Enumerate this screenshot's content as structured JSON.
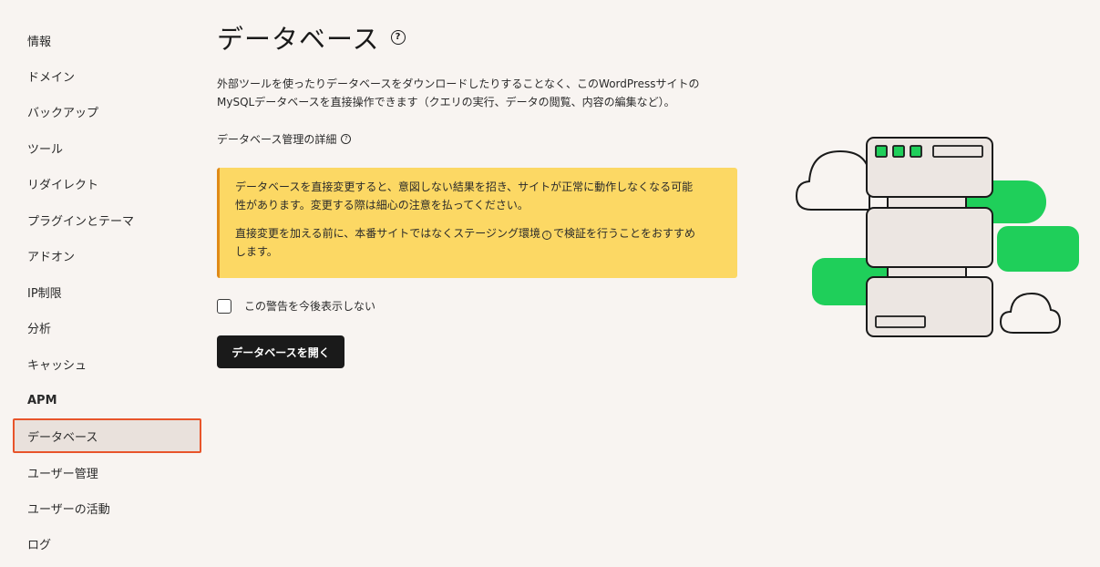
{
  "sidebar": {
    "items": [
      {
        "label": "情報"
      },
      {
        "label": "ドメイン"
      },
      {
        "label": "バックアップ"
      },
      {
        "label": "ツール"
      },
      {
        "label": "リダイレクト"
      },
      {
        "label": "プラグインとテーマ"
      },
      {
        "label": "アドオン"
      },
      {
        "label": "IP制限"
      },
      {
        "label": "分析"
      },
      {
        "label": "キャッシュ"
      },
      {
        "label": "APM"
      },
      {
        "label": "データベース"
      },
      {
        "label": "ユーザー管理"
      },
      {
        "label": "ユーザーの活動"
      },
      {
        "label": "ログ"
      }
    ],
    "active_label": "データベース"
  },
  "main": {
    "title": "データベース",
    "description_line1": "外部ツールを使ったりデータベースをダウンロードしたりすることなく、このWordPressサイトの",
    "description_line2": "MySQLデータベースを直接操作できます（クエリの実行、データの閲覧、内容の編集など）。",
    "details_link": "データベース管理の詳細",
    "warning": {
      "paragraph1_line1": "データベースを直接変更すると、意図しない結果を招き、サイトが正常に動作しなくなる可能",
      "paragraph1_line2": "性があります。変更する際は細心の注意を払ってください。",
      "paragraph2_before_icon": "直接変更を加える前に、本番サイトではなくステージング環境",
      "paragraph2_after_icon": "で検証を行うことをおすすめ",
      "paragraph2_line2": "します。"
    },
    "dont_show_label": "この警告を今後表示しない",
    "open_button_label": "データベースを開く"
  },
  "icons": {
    "title_help": "?",
    "details_help": "?",
    "staging_info": "i"
  },
  "colors": {
    "background": "#f8f4f1",
    "warning_bg": "#fcd864",
    "warning_border": "#e08a17",
    "active_border": "#e8542a",
    "active_bg": "#e9e1dc",
    "button_bg": "#1a1a1a",
    "accent_green": "#1fcf5a"
  }
}
